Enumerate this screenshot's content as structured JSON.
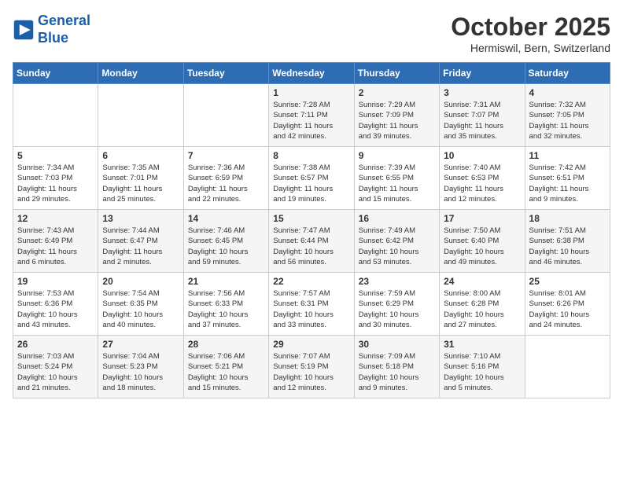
{
  "header": {
    "logo_line1": "General",
    "logo_line2": "Blue",
    "month": "October 2025",
    "location": "Hermiswil, Bern, Switzerland"
  },
  "days_of_week": [
    "Sunday",
    "Monday",
    "Tuesday",
    "Wednesday",
    "Thursday",
    "Friday",
    "Saturday"
  ],
  "weeks": [
    [
      {
        "day": "",
        "info": ""
      },
      {
        "day": "",
        "info": ""
      },
      {
        "day": "",
        "info": ""
      },
      {
        "day": "1",
        "info": "Sunrise: 7:28 AM\nSunset: 7:11 PM\nDaylight: 11 hours\nand 42 minutes."
      },
      {
        "day": "2",
        "info": "Sunrise: 7:29 AM\nSunset: 7:09 PM\nDaylight: 11 hours\nand 39 minutes."
      },
      {
        "day": "3",
        "info": "Sunrise: 7:31 AM\nSunset: 7:07 PM\nDaylight: 11 hours\nand 35 minutes."
      },
      {
        "day": "4",
        "info": "Sunrise: 7:32 AM\nSunset: 7:05 PM\nDaylight: 11 hours\nand 32 minutes."
      }
    ],
    [
      {
        "day": "5",
        "info": "Sunrise: 7:34 AM\nSunset: 7:03 PM\nDaylight: 11 hours\nand 29 minutes."
      },
      {
        "day": "6",
        "info": "Sunrise: 7:35 AM\nSunset: 7:01 PM\nDaylight: 11 hours\nand 25 minutes."
      },
      {
        "day": "7",
        "info": "Sunrise: 7:36 AM\nSunset: 6:59 PM\nDaylight: 11 hours\nand 22 minutes."
      },
      {
        "day": "8",
        "info": "Sunrise: 7:38 AM\nSunset: 6:57 PM\nDaylight: 11 hours\nand 19 minutes."
      },
      {
        "day": "9",
        "info": "Sunrise: 7:39 AM\nSunset: 6:55 PM\nDaylight: 11 hours\nand 15 minutes."
      },
      {
        "day": "10",
        "info": "Sunrise: 7:40 AM\nSunset: 6:53 PM\nDaylight: 11 hours\nand 12 minutes."
      },
      {
        "day": "11",
        "info": "Sunrise: 7:42 AM\nSunset: 6:51 PM\nDaylight: 11 hours\nand 9 minutes."
      }
    ],
    [
      {
        "day": "12",
        "info": "Sunrise: 7:43 AM\nSunset: 6:49 PM\nDaylight: 11 hours\nand 6 minutes."
      },
      {
        "day": "13",
        "info": "Sunrise: 7:44 AM\nSunset: 6:47 PM\nDaylight: 11 hours\nand 2 minutes."
      },
      {
        "day": "14",
        "info": "Sunrise: 7:46 AM\nSunset: 6:45 PM\nDaylight: 10 hours\nand 59 minutes."
      },
      {
        "day": "15",
        "info": "Sunrise: 7:47 AM\nSunset: 6:44 PM\nDaylight: 10 hours\nand 56 minutes."
      },
      {
        "day": "16",
        "info": "Sunrise: 7:49 AM\nSunset: 6:42 PM\nDaylight: 10 hours\nand 53 minutes."
      },
      {
        "day": "17",
        "info": "Sunrise: 7:50 AM\nSunset: 6:40 PM\nDaylight: 10 hours\nand 49 minutes."
      },
      {
        "day": "18",
        "info": "Sunrise: 7:51 AM\nSunset: 6:38 PM\nDaylight: 10 hours\nand 46 minutes."
      }
    ],
    [
      {
        "day": "19",
        "info": "Sunrise: 7:53 AM\nSunset: 6:36 PM\nDaylight: 10 hours\nand 43 minutes."
      },
      {
        "day": "20",
        "info": "Sunrise: 7:54 AM\nSunset: 6:35 PM\nDaylight: 10 hours\nand 40 minutes."
      },
      {
        "day": "21",
        "info": "Sunrise: 7:56 AM\nSunset: 6:33 PM\nDaylight: 10 hours\nand 37 minutes."
      },
      {
        "day": "22",
        "info": "Sunrise: 7:57 AM\nSunset: 6:31 PM\nDaylight: 10 hours\nand 33 minutes."
      },
      {
        "day": "23",
        "info": "Sunrise: 7:59 AM\nSunset: 6:29 PM\nDaylight: 10 hours\nand 30 minutes."
      },
      {
        "day": "24",
        "info": "Sunrise: 8:00 AM\nSunset: 6:28 PM\nDaylight: 10 hours\nand 27 minutes."
      },
      {
        "day": "25",
        "info": "Sunrise: 8:01 AM\nSunset: 6:26 PM\nDaylight: 10 hours\nand 24 minutes."
      }
    ],
    [
      {
        "day": "26",
        "info": "Sunrise: 7:03 AM\nSunset: 5:24 PM\nDaylight: 10 hours\nand 21 minutes."
      },
      {
        "day": "27",
        "info": "Sunrise: 7:04 AM\nSunset: 5:23 PM\nDaylight: 10 hours\nand 18 minutes."
      },
      {
        "day": "28",
        "info": "Sunrise: 7:06 AM\nSunset: 5:21 PM\nDaylight: 10 hours\nand 15 minutes."
      },
      {
        "day": "29",
        "info": "Sunrise: 7:07 AM\nSunset: 5:19 PM\nDaylight: 10 hours\nand 12 minutes."
      },
      {
        "day": "30",
        "info": "Sunrise: 7:09 AM\nSunset: 5:18 PM\nDaylight: 10 hours\nand 9 minutes."
      },
      {
        "day": "31",
        "info": "Sunrise: 7:10 AM\nSunset: 5:16 PM\nDaylight: 10 hours\nand 5 minutes."
      },
      {
        "day": "",
        "info": ""
      }
    ]
  ]
}
